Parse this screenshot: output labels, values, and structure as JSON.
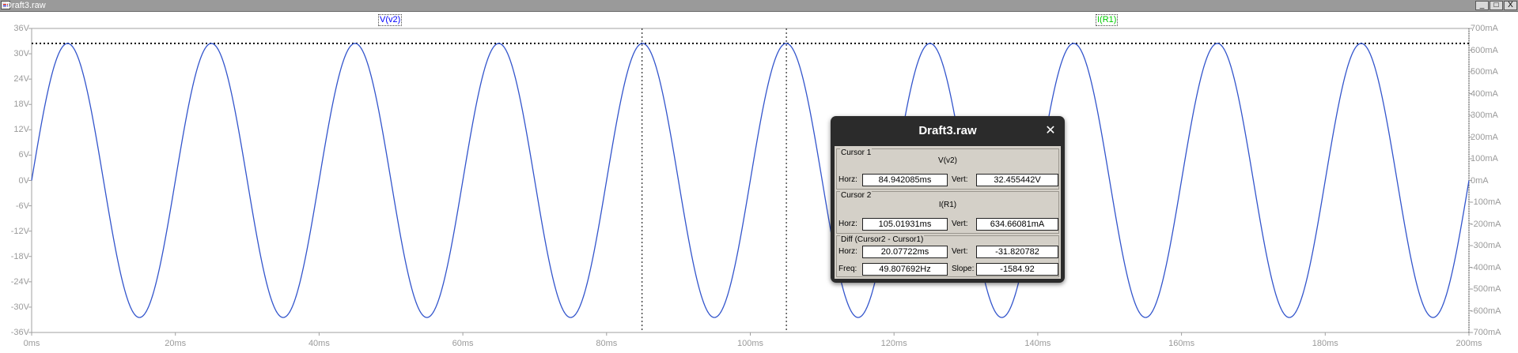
{
  "window": {
    "title": "Draft3.raw",
    "min_glyph": "_",
    "max_glyph": "□",
    "close_glyph": "X"
  },
  "traces": [
    {
      "label": "V(v2)",
      "color": "#0000ff"
    },
    {
      "label": "I(R1)",
      "color": "#00cc00"
    }
  ],
  "axes": {
    "left_ticks": [
      "36V",
      "30V",
      "24V",
      "18V",
      "12V",
      "6V",
      "0V",
      "-6V",
      "-12V",
      "-18V",
      "-24V",
      "-30V",
      "-36V"
    ],
    "right_ticks": [
      "700mA",
      "600mA",
      "500mA",
      "400mA",
      "300mA",
      "200mA",
      "100mA",
      "0mA",
      "-100mA",
      "-200mA",
      "-300mA",
      "-400mA",
      "-500mA",
      "-600mA",
      "-700mA"
    ],
    "x_ticks": [
      "0ms",
      "20ms",
      "40ms",
      "60ms",
      "80ms",
      "100ms",
      "120ms",
      "140ms",
      "160ms",
      "180ms",
      "200ms"
    ]
  },
  "chart_data": {
    "type": "line",
    "x_unit": "ms",
    "xlim": [
      0,
      200
    ],
    "ylim_left": [
      -36,
      36
    ],
    "ylim_right": [
      -700,
      700
    ],
    "waveform": "sine",
    "amplitude_V": 32.45,
    "frequency_Hz": 50,
    "series": [
      {
        "name": "V(v2)",
        "color": "#3355cc"
      }
    ],
    "cursors_ms": [
      84.942085,
      105.01931
    ],
    "horizontal_cursor_V": 32.455442,
    "grid": false,
    "dotted_border_right": true
  },
  "dialog": {
    "title": "Draft3.raw",
    "close_glyph": "✕",
    "cursor1": {
      "group_label": "Cursor 1",
      "trace": "V(v2)",
      "horz_label": "Horz:",
      "horz": "84.942085ms",
      "vert_label": "Vert:",
      "vert": "32.455442V"
    },
    "cursor2": {
      "group_label": "Cursor 2",
      "trace": "I(R1)",
      "horz_label": "Horz:",
      "horz": "105.01931ms",
      "vert_label": "Vert:",
      "vert": "634.66081mA"
    },
    "diff": {
      "group_label": "Diff (Cursor2 - Cursor1)",
      "horz_label": "Horz:",
      "horz": "20.07722ms",
      "vert_label": "Vert:",
      "vert": "-31.820782",
      "freq_label": "Freq:",
      "freq": "49.807692Hz",
      "slope_label": "Slope:",
      "slope": "-1584.92"
    }
  }
}
